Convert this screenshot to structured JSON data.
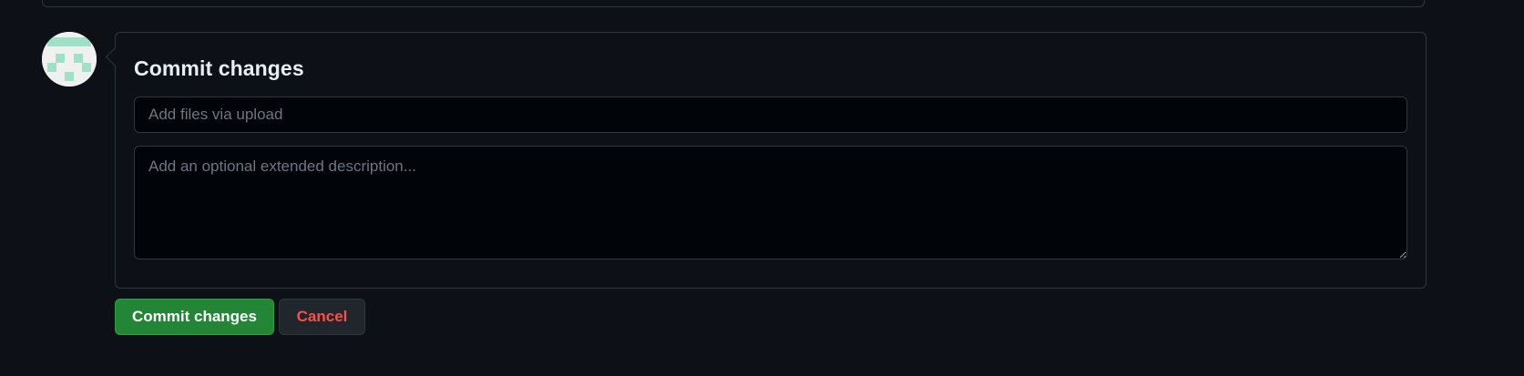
{
  "commit": {
    "title": "Commit changes",
    "summary_placeholder": "Add files via upload",
    "summary_value": "",
    "description_placeholder": "Add an optional extended description...",
    "description_value": ""
  },
  "buttons": {
    "commit_label": "Commit changes",
    "cancel_label": "Cancel"
  },
  "avatar": {
    "icon": "identicon-avatar",
    "color": "#9fe0c9"
  },
  "colors": {
    "background": "#0d1117",
    "border": "#30363d",
    "primary": "#238636",
    "danger": "#f85149"
  }
}
